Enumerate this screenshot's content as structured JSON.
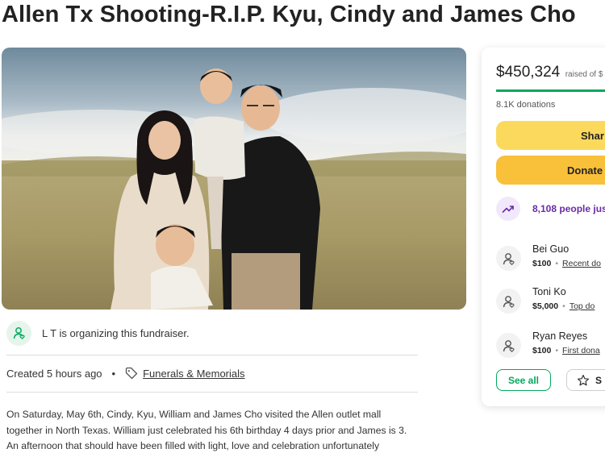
{
  "campaign": {
    "title": "Allen Tx Shooting-R.I.P. Kyu, Cindy and James Cho"
  },
  "organizer": {
    "text": "L T is organizing this fundraiser."
  },
  "meta": {
    "created": "Created 5 hours ago",
    "category": "Funerals & Memorials"
  },
  "story": {
    "text": "On Saturday, May 6th, Cindy, Kyu, William and James Cho visited the Allen outlet mall together in North Texas. William just celebrated his 6th birthday 4 days prior and James is 3. An afternoon that should have been filled with light, love and celebration unfortunately"
  },
  "sidebar": {
    "raised_amount": "$450,324",
    "raised_of": "raised of $",
    "donations_count": "8.1K donations",
    "share_label": "Shar",
    "donate_label": "Donate",
    "trending_text": "8,108 people jus",
    "donors": [
      {
        "name": "Bei Guo",
        "amount": "$100",
        "tag": "Recent do"
      },
      {
        "name": "Toni Ko",
        "amount": "$5,000",
        "tag": "Top do"
      },
      {
        "name": "Ryan Reyes",
        "amount": "$100",
        "tag": "First dona"
      }
    ],
    "see_all_label": "See all",
    "top_donations_label": "S"
  },
  "colors": {
    "brand_green": "#02a95c",
    "share_yellow": "#fbd95d",
    "donate_orange": "#f9c03a",
    "trending_purple": "#6a2ba8"
  },
  "icons": {
    "organizer": "user-heart-icon",
    "category": "tag-icon",
    "trending": "trending-up-icon",
    "donor": "user-heart-icon",
    "top_donations": "star-icon"
  }
}
